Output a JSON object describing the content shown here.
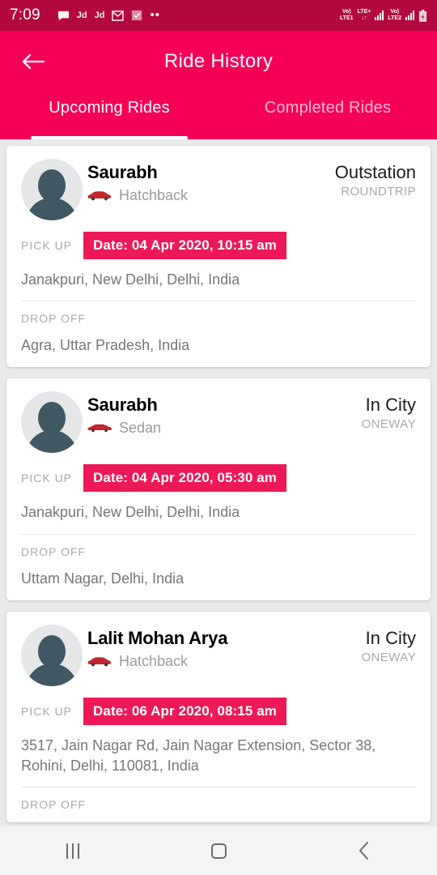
{
  "status_bar": {
    "clock": "7:09",
    "left_icons": [
      "chat-bubble-icon",
      "jd-icon",
      "jd-icon",
      "envelope-icon",
      "checkbox-icon",
      "more-dots-icon"
    ],
    "jd_label": "Jd",
    "dots_label": "••",
    "sim1": {
      "line1": "Vo)",
      "line2": "LTE1"
    },
    "lte_plus": {
      "line1": "LTE+",
      "line2": "↓↑"
    },
    "sim2": {
      "line1": "Vo)",
      "line2": "LTE2"
    },
    "battery_icon": "battery-icon"
  },
  "header": {
    "back_icon": "back-arrow-icon",
    "title": "Ride History",
    "tabs": [
      {
        "label": "Upcoming Rides",
        "active": true
      },
      {
        "label": "Completed Rides",
        "active": false
      }
    ]
  },
  "labels": {
    "pick_up": "PICK UP",
    "drop_off": "DROP OFF"
  },
  "colors": {
    "status_bar": "#b3093f",
    "header": "#f50057",
    "date_badge": "#ec1857",
    "page_bg": "#e9e9e9",
    "card_bg": "#ffffff",
    "muted_text": "#a9a9a9",
    "address_text": "#777777"
  },
  "rides": [
    {
      "avatar_icon": "person-avatar-icon",
      "name": "Saurabh",
      "car_icon": "car-icon",
      "car_type": "Hatchback",
      "trip_kind": "Outstation",
      "trip_way": "ROUNDTRIP",
      "date": "Date: 04 Apr 2020, 10:15 am",
      "pickup_address": "Janakpuri, New Delhi, Delhi, India",
      "dropoff_address": "Agra, Uttar Pradesh, India"
    },
    {
      "avatar_icon": "person-avatar-icon",
      "name": "Saurabh",
      "car_icon": "car-icon",
      "car_type": "Sedan",
      "trip_kind": "In City",
      "trip_way": "ONEWAY",
      "date": "Date: 04 Apr 2020, 05:30 am",
      "pickup_address": "Janakpuri, New Delhi, Delhi, India",
      "dropoff_address": "Uttam Nagar, Delhi, India"
    },
    {
      "avatar_icon": "person-avatar-icon",
      "name": "Lalit Mohan Arya",
      "car_icon": "car-icon",
      "car_type": "Hatchback",
      "trip_kind": "In City",
      "trip_way": "ONEWAY",
      "date": "Date: 06 Apr 2020, 08:15 am",
      "pickup_address": "3517, Jain Nagar Rd, Jain Nagar Extension, Sector 38, Rohini, Delhi, 110081, India",
      "dropoff_address": ""
    }
  ],
  "nav_bar": {
    "recents_icon": "recents-icon",
    "home_icon": "home-icon",
    "back_icon": "back-nav-icon"
  }
}
